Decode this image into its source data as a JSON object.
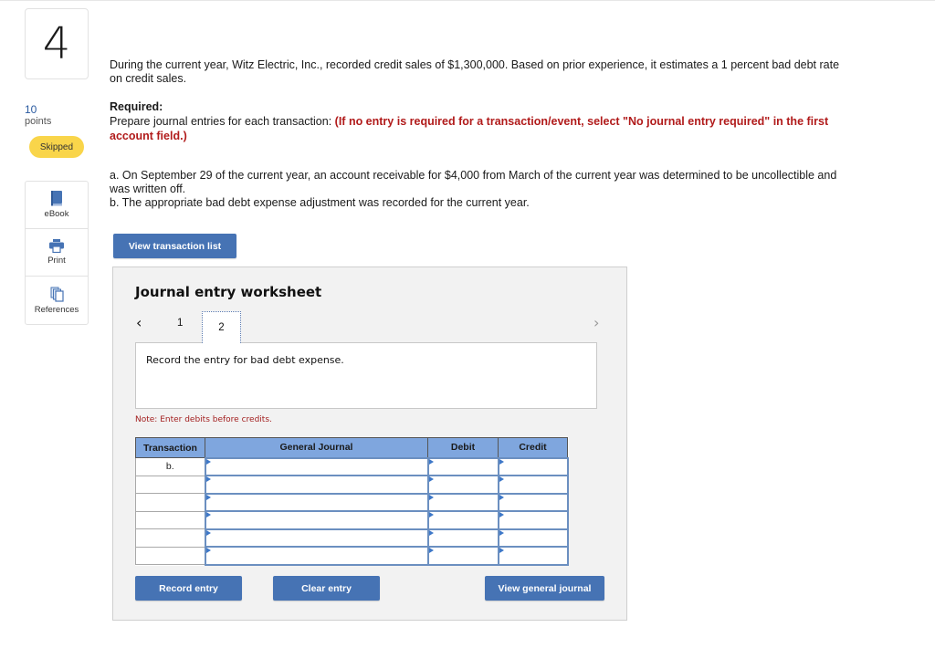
{
  "question": {
    "number": "4",
    "points_value": "10",
    "points_label": "points",
    "status": "Skipped"
  },
  "tools": [
    {
      "label": "eBook",
      "icon": "book-icon"
    },
    {
      "label": "Print",
      "icon": "printer-icon"
    },
    {
      "label": "References",
      "icon": "documents-icon"
    }
  ],
  "problem": {
    "intro": "During the current year, Witz Electric, Inc., recorded credit sales of $1,300,000. Based on prior experience, it estimates a 1 percent bad debt rate on credit sales.",
    "required_heading": "Required:",
    "required_text": "Prepare journal entries for each transaction: ",
    "required_instruction": "(If no entry is required for a transaction/event, select \"No journal entry required\" in the first account field.)",
    "transaction_a": "a. On September 29 of the current year, an account receivable for $4,000 from March of the current year was determined to be uncollectible and was written off.",
    "transaction_b": "b. The appropriate bad debt expense adjustment was recorded for the current year."
  },
  "buttons": {
    "view_transaction_list": "View transaction list",
    "record_entry": "Record entry",
    "clear_entry": "Clear entry",
    "view_general_journal": "View general journal"
  },
  "worksheet": {
    "title": "Journal entry worksheet",
    "prev_icon": "<",
    "next_icon": ">",
    "pages": [
      "1",
      "2"
    ],
    "current_page": "2",
    "prompt": "Record the entry for bad debt expense.",
    "note": "Note: Enter debits before credits.",
    "table": {
      "headers": [
        "Transaction",
        "General Journal",
        "Debit",
        "Credit"
      ],
      "rows": [
        {
          "transaction": "b.",
          "account": "",
          "debit": "",
          "credit": ""
        },
        {
          "transaction": "",
          "account": "",
          "debit": "",
          "credit": ""
        },
        {
          "transaction": "",
          "account": "",
          "debit": "",
          "credit": ""
        },
        {
          "transaction": "",
          "account": "",
          "debit": "",
          "credit": ""
        },
        {
          "transaction": "",
          "account": "",
          "debit": "",
          "credit": ""
        },
        {
          "transaction": "",
          "account": "",
          "debit": "",
          "credit": ""
        }
      ]
    }
  },
  "colors": {
    "accent_blue": "#4673b4",
    "table_header": "#7fa6de",
    "instruction_red": "#b11b1b",
    "skipped_badge": "#f9d54a"
  }
}
